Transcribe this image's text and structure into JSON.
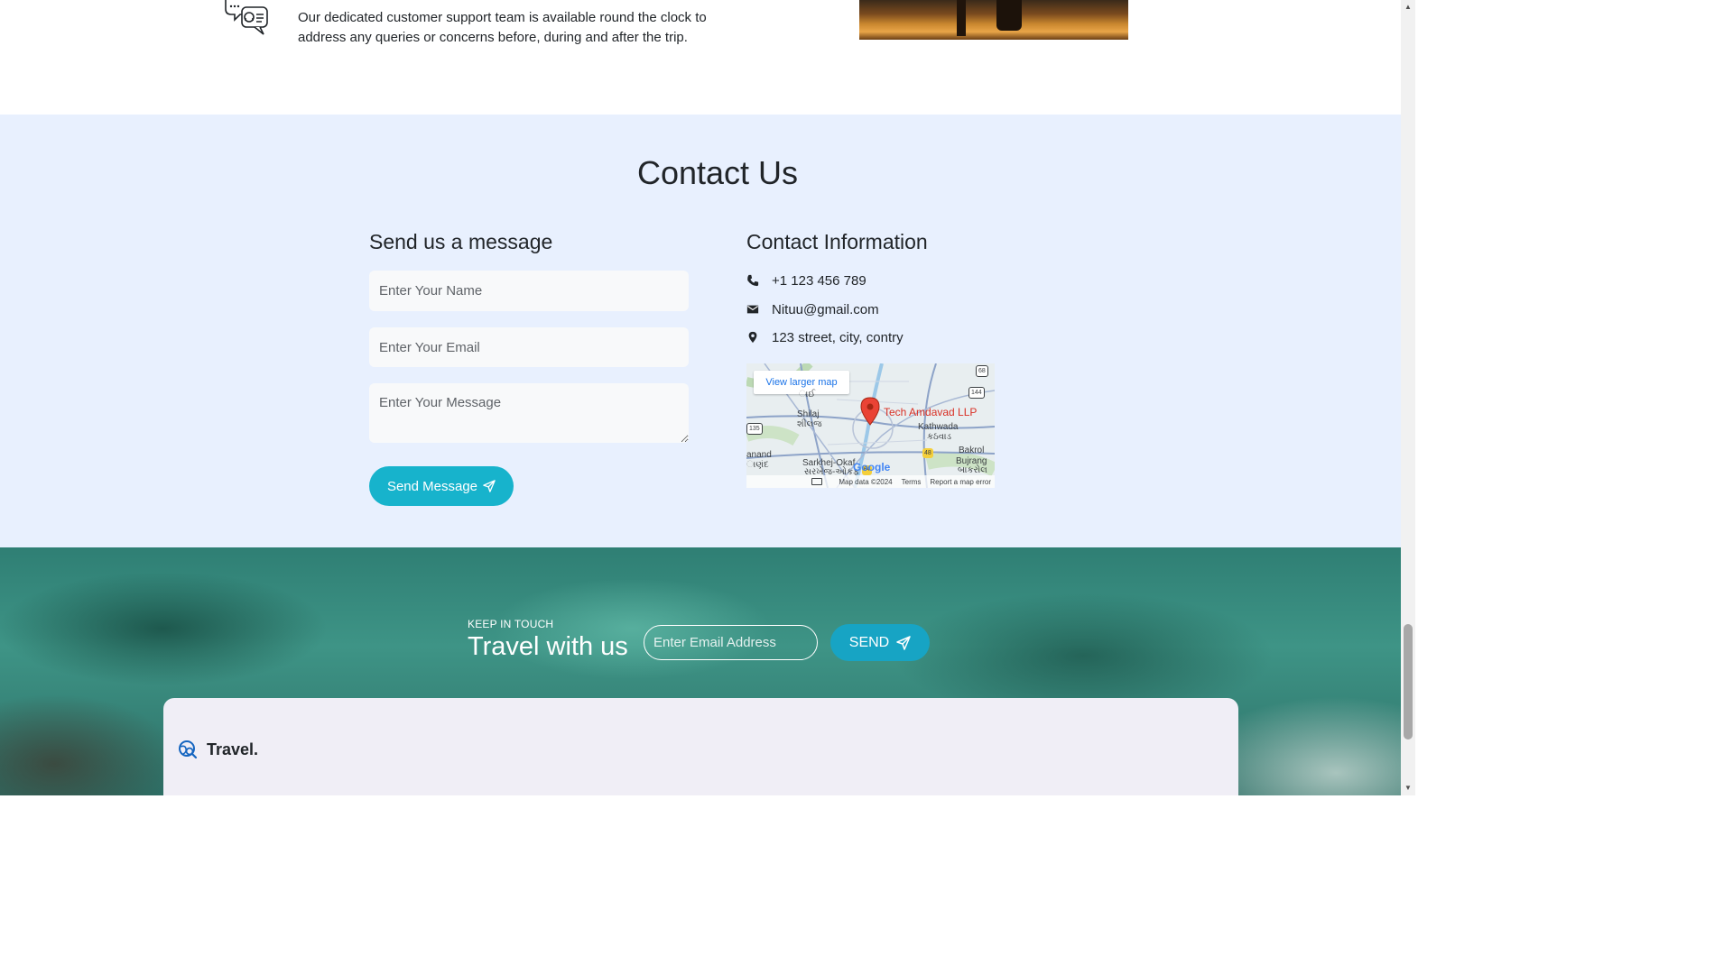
{
  "features": {
    "support_text": "Our dedicated customer support team is available round the clock to address any queries or concerns before, during and after the trip."
  },
  "contact": {
    "title": "Contact Us",
    "form": {
      "heading": "Send us a message",
      "name_placeholder": "Enter Your Name",
      "email_placeholder": "Enter Your Email",
      "message_placeholder": "Enter Your Message",
      "submit_label": "Send Message"
    },
    "info": {
      "heading": "Contact Information",
      "phone": "+1 123 456 789",
      "email": "Nituu@gmail.com",
      "address": "123 street, city, contry"
    },
    "map": {
      "view_larger": "View larger map",
      "place_name": "Tech Amdavad LLP",
      "labels": [
        "Shilaj",
        "શીલજ",
        "Kathwada",
        "કઠવાડ",
        "Bakrol",
        "Bujrang",
        "બાકરોલ",
        "Sarkhej-Okaf",
        "સરખેજ-ઓકફ",
        "anand",
        "ાણંદ",
        "ાઈ"
      ],
      "road_badges": [
        "68",
        "144",
        "135",
        "48",
        "64"
      ],
      "attribution": "Google",
      "footer": [
        "Map data ©2024",
        "Terms",
        "Report a map error"
      ]
    }
  },
  "newsletter": {
    "eyebrow": "KEEP IN TOUCH",
    "title": "Travel with us",
    "email_placeholder": "Enter Email Address",
    "button_label": "SEND"
  },
  "footer": {
    "brand": "Travel."
  },
  "colors": {
    "accent": "#17b3cc",
    "section_bg": "#e8f0fe",
    "footer_card": "#f0eef6",
    "pin": "#d93025"
  },
  "icons": [
    "support-chat-icon",
    "phone-icon",
    "mail-icon",
    "location-pin-icon",
    "send-icon",
    "globe-search-icon",
    "keyboard-icon"
  ]
}
